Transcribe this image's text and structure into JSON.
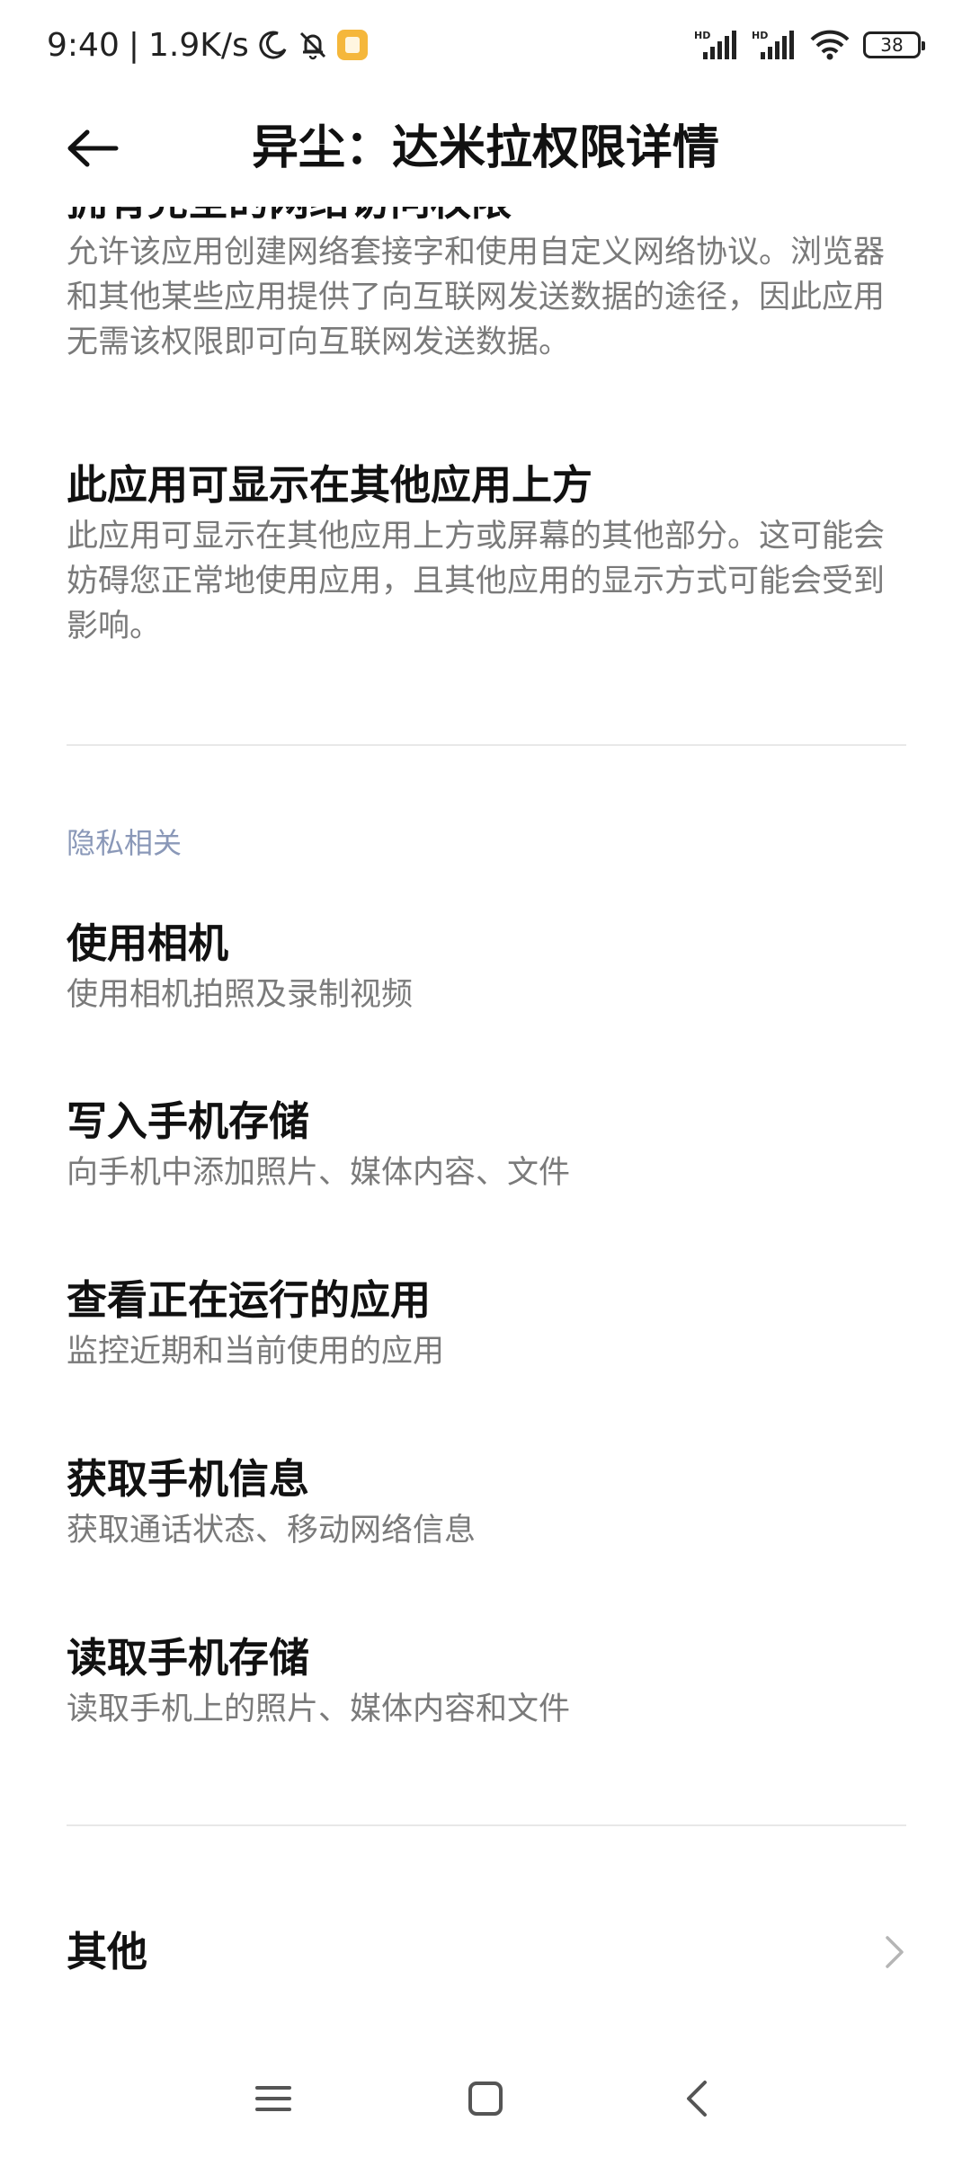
{
  "status_bar": {
    "time": "9:40",
    "separator": "|",
    "net_speed": "1.9K/s",
    "battery": "38",
    "icons": [
      "moon-icon",
      "bell-off-icon",
      "notification-app-icon",
      "hd-signal-icon",
      "hd-signal-icon",
      "wifi-icon",
      "battery-icon"
    ]
  },
  "header": {
    "back_icon": "arrow-left-icon",
    "title": "异尘：达米拉权限详情"
  },
  "permissions_top": [
    {
      "title": "拥有完全的网络访问权限",
      "description": "允许该应用创建网络套接字和使用自定义网络协议。浏览器和其他某些应用提供了向互联网发送数据的途径，因此应用无需该权限即可向互联网发送数据。"
    },
    {
      "title": "此应用可显示在其他应用上方",
      "description": "此应用可显示在其他应用上方或屏幕的其他部分。这可能会妨碍您正常地使用应用，且其他应用的显示方式可能会受到影响。"
    }
  ],
  "privacy_section": {
    "header": "隐私相关",
    "items": [
      {
        "title": "使用相机",
        "description": "使用相机拍照及录制视频"
      },
      {
        "title": "写入手机存储",
        "description": "向手机中添加照片、媒体内容、文件"
      },
      {
        "title": "查看正在运行的应用",
        "description": "监控近期和当前使用的应用"
      },
      {
        "title": "获取手机信息",
        "description": "获取通话状态、移动网络信息"
      },
      {
        "title": "读取手机存储",
        "description": "读取手机上的照片、媒体内容和文件"
      }
    ]
  },
  "other": {
    "label": "其他",
    "icon": "chevron-right-icon"
  },
  "nav_bar": {
    "icons": [
      "menu-icon",
      "home-square-icon",
      "back-chevron-icon"
    ]
  },
  "colors": {
    "background": "#ffffff",
    "title_text": "#111111",
    "description_text": "#7a7a7a",
    "section_header": "#8a98b8",
    "divider": "#e8e8e8"
  }
}
